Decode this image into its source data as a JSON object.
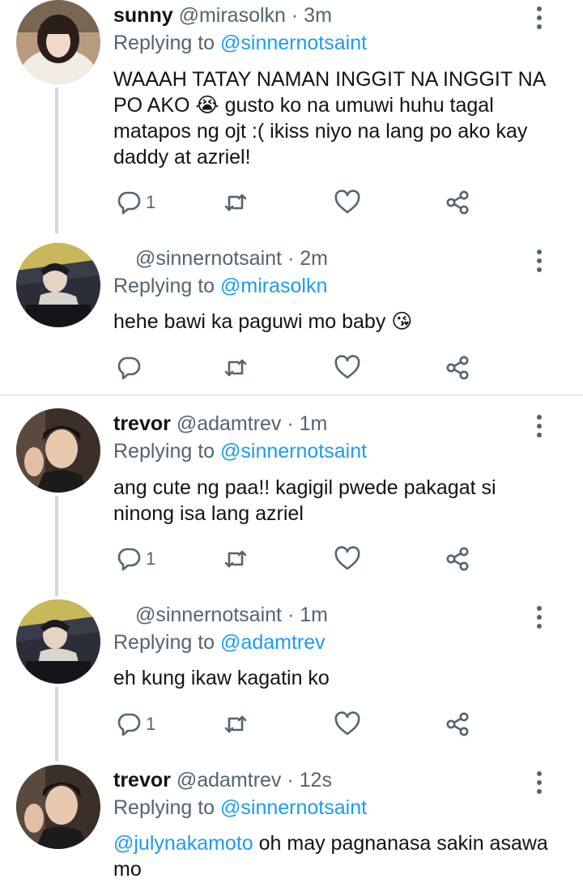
{
  "replying_prefix": "Replying to",
  "tweets": [
    {
      "name": "sunny",
      "handle": "@mirasolkn",
      "time": "· 3m",
      "replying_to": "@sinnernotsaint",
      "text": "WAAAH TATAY NAMAN INGGIT NA INGGIT NA PO AKO 😭 gusto ko na umuwi huhu tagal matapos ng ojt :( ikiss niyo na lang po ako kay daddy at azriel!",
      "reply_count": "1"
    },
    {
      "name": "",
      "handle": "@sinnernotsaint",
      "time": "· 2m",
      "replying_to": "@mirasolkn",
      "text": "hehe bawi ka paguwi mo baby 😘",
      "reply_count": ""
    },
    {
      "name": "trevor",
      "handle": "@adamtrev",
      "time": "· 1m",
      "replying_to": "@sinnernotsaint",
      "text": "ang cute ng paa!! kagigil pwede pakagat si ninong isa lang azriel",
      "reply_count": "1"
    },
    {
      "name": "",
      "handle": "@sinnernotsaint",
      "time": "· 1m",
      "replying_to": "@adamtrev",
      "text": "eh kung ikaw kagatin ko",
      "reply_count": "1"
    },
    {
      "name": "trevor",
      "handle": "@adamtrev",
      "time": "· 12s",
      "replying_to": "@sinnernotsaint",
      "text_mention": "@julynakamoto",
      "text": " oh may pagnanasa sakin asawa mo",
      "reply_count": ""
    }
  ],
  "colors": {
    "accent": "#1d9bf0",
    "secondary": "#536471",
    "line": "#cfd9de"
  }
}
